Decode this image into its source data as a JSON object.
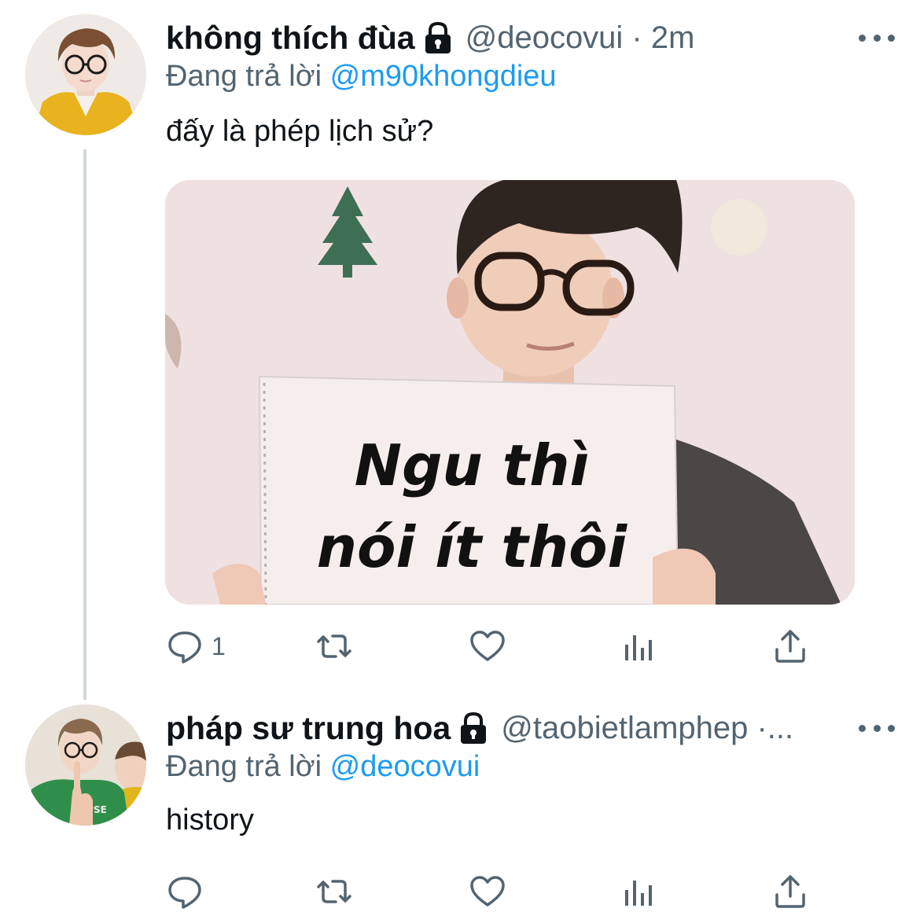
{
  "tweets": [
    {
      "display_name": "không thích đùa",
      "handle_time": "@deocovui · 2m",
      "replying_prefix": "Đang trả lời",
      "replying_to": "@m90khongdieu",
      "text": "đấy là phép lịch sử?",
      "media": {
        "sign_line_1": "Ngu thì",
        "sign_line_2": "nói ít thôi"
      },
      "actions": {
        "reply_count": "1",
        "retweet_count": "",
        "like_count": ""
      }
    },
    {
      "display_name": "pháp sư trung hoa",
      "handle_time": "@taobietlamphep ·...",
      "replying_prefix": "Đang trả lời",
      "replying_to": "@deocovui",
      "text": "history",
      "actions": {
        "reply_count": "",
        "retweet_count": "",
        "like_count": ""
      }
    }
  ],
  "colors": {
    "text_primary": "#0f1419",
    "text_secondary": "#536471",
    "link": "#1d9bf0",
    "thread_line": "#cfd9de"
  },
  "icons": [
    "lock-icon",
    "more-icon",
    "reply-icon",
    "retweet-icon",
    "like-icon",
    "analytics-icon",
    "share-icon"
  ]
}
